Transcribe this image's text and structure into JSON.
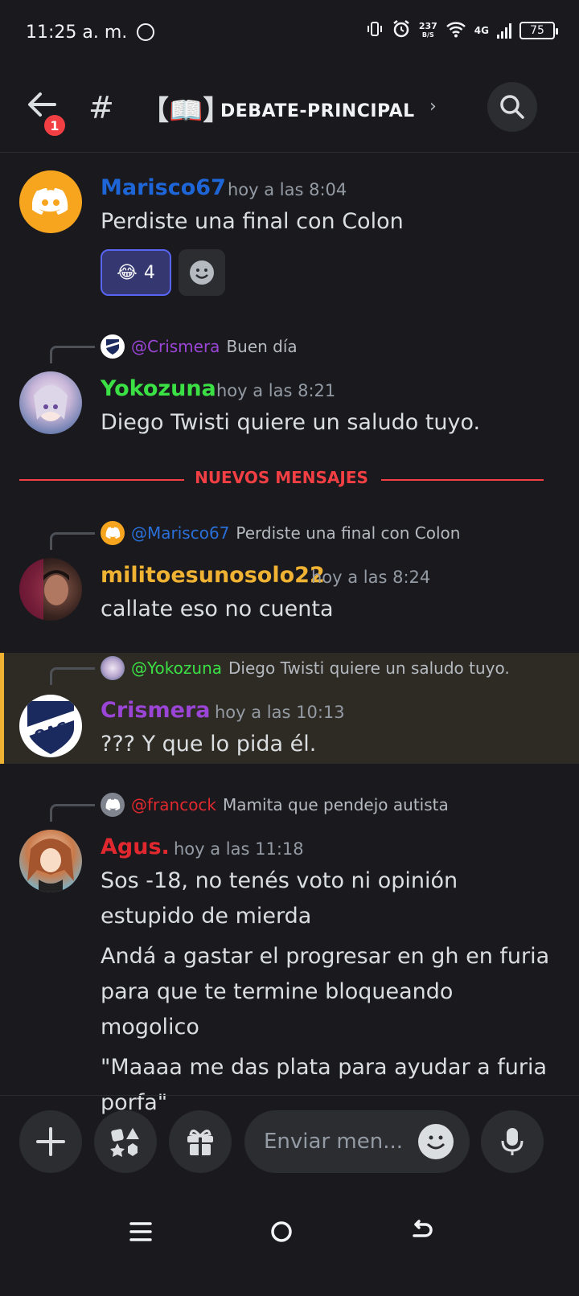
{
  "status_bar": {
    "time": "11:25 a. m.",
    "speed_value": "237",
    "speed_unit": "B/S",
    "network": "4G",
    "battery": "75"
  },
  "header": {
    "notification_count": "1",
    "channel_prefix": "【📖】",
    "channel_name": "DEBATE-PRINCIPAL"
  },
  "messages": [
    {
      "author": "Marisco67",
      "author_color": "#1e66d8",
      "timestamp": "hoy a las 8:04",
      "lines": [
        "Perdiste una final con Colon"
      ],
      "reactions": [
        {
          "emoji": "😂",
          "count": "4"
        }
      ]
    },
    {
      "reply_to": "@Crismera",
      "reply_to_color": "#9b45d6",
      "reply_text": "Buen día",
      "author": "Yokozuna",
      "author_color": "#3be045",
      "timestamp": "hoy a las 8:21",
      "lines": [
        "Diego Twisti quiere un saludo tuyo."
      ]
    },
    {
      "reply_to": "@Marisco67",
      "reply_to_color": "#2a6fd8",
      "reply_text": "Perdiste una final con Colon",
      "author": "militoesunosolo22",
      "author_color": "#f0b232",
      "timestamp": "hoy a las 8:24",
      "lines": [
        "callate eso no cuenta"
      ]
    },
    {
      "reply_to": "@Yokozuna",
      "reply_to_color": "#3be045",
      "reply_text": "Diego Twisti quiere un saludo tuyo.",
      "author": "Crismera",
      "author_color": "#9b45d6",
      "timestamp": "hoy a las 10:13",
      "lines": [
        "???  Y que lo pida él."
      ]
    },
    {
      "reply_to": "@francock",
      "reply_to_color": "#e0282e",
      "reply_text": "Mamita que pendejo autista",
      "author": "Agus.",
      "author_color": "#e0282e",
      "timestamp": "hoy a las 11:18",
      "lines": [
        "Sos -18, no tenés voto ni opinión estupido de mierda",
        "Andá a gastar el progresar en gh en furia para que te termine bloqueando mogolico",
        "\"Maaaa me das plata para ayudar a furia porfa\""
      ]
    }
  ],
  "divider": {
    "label": "NUEVOS MENSAJES"
  },
  "composer": {
    "placeholder": "Enviar men..."
  },
  "icons": [
    "whatsapp-icon",
    "vibrate-icon",
    "alarm-icon",
    "wifi-icon",
    "signal-icon",
    "battery-icon",
    "back-arrow-icon",
    "hash-icon",
    "search-icon",
    "discord-logo-icon",
    "qac-logo-icon",
    "laughing-emoji-icon",
    "add-reaction-icon",
    "plus-icon",
    "apps-icon",
    "gift-icon",
    "emoji-icon",
    "microphone-icon",
    "menu-icon",
    "home-icon",
    "nav-back-icon"
  ],
  "colors": {
    "background": "#1a1a1e",
    "accent": "#5865f2",
    "new_messages": "#f23f43",
    "highlight_bar": "#f0b232"
  }
}
